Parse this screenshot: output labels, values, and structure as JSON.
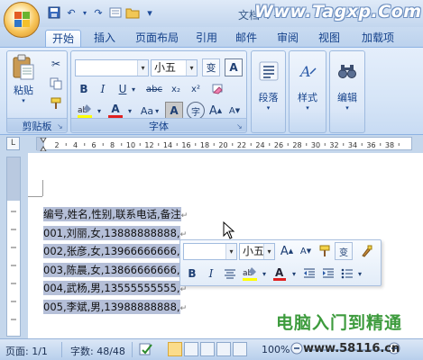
{
  "window": {
    "title": "文档 4 - ",
    "watermark_top": "Www.Tagxp.Com"
  },
  "qat": {
    "icons": [
      "save-icon",
      "undo-icon",
      "redo-icon",
      "open-icon",
      "customize-icon"
    ],
    "undo": "↶",
    "redo": "↷",
    "customize": "▾"
  },
  "tabs": [
    {
      "label": "开始",
      "active": true
    },
    {
      "label": "插入"
    },
    {
      "label": "页面布局"
    },
    {
      "label": "引用"
    },
    {
      "label": "邮件"
    },
    {
      "label": "审阅"
    },
    {
      "label": "视图"
    },
    {
      "label": "加载项"
    }
  ],
  "ribbon": {
    "clipboard": {
      "label": "剪贴板",
      "paste": "粘贴",
      "cut": "✂",
      "launcher": "↘"
    },
    "font": {
      "label": "字体",
      "font_size": "小五",
      "wen": "变",
      "a_box": "A",
      "bold": "B",
      "italic": "I",
      "underline": "U",
      "strike": "abc",
      "sub": "x₂",
      "sup": "x²",
      "clear": "Aa",
      "font_color": "A",
      "shade": "A",
      "enclose": "字",
      "grow": "A",
      "shrink": "A",
      "launcher": "↘"
    },
    "paragraph": {
      "label": "段落"
    },
    "styles": {
      "label": "样式"
    },
    "editing": {
      "label": "编辑"
    }
  },
  "ruler": {
    "corner": "L",
    "ticks": [
      "2",
      "4",
      "6",
      "8",
      "10",
      "12",
      "14",
      "16",
      "18",
      "20",
      "22",
      "24",
      "26",
      "28",
      "30",
      "32",
      "34",
      "36",
      "38"
    ]
  },
  "document": {
    "lines": [
      "编号,姓名,性别,联系电话,备注",
      "001,刘丽,女,13888888888,",
      "002,张彦,女,13966666666,",
      "003,陈晨,女,13866666666,",
      "004,武杨,男,13555555555,",
      "005,李斌,男,13988888888,"
    ],
    "para_mark": "↵"
  },
  "mini_toolbar": {
    "font_size": "小五",
    "grow": "A",
    "shrink": "A",
    "bold": "B",
    "italic": "I",
    "format_painter": "变"
  },
  "status": {
    "page": "页面: 1/1",
    "words": "字数: 48/48",
    "zoom": "100%"
  },
  "watermark_bottom": {
    "brand": "电脑入门到精通",
    "url": "www.58116.cn"
  },
  "colors": {
    "ribbon": "#dce8f8",
    "selection": "#b5bfd8",
    "accent": "#15428b"
  }
}
